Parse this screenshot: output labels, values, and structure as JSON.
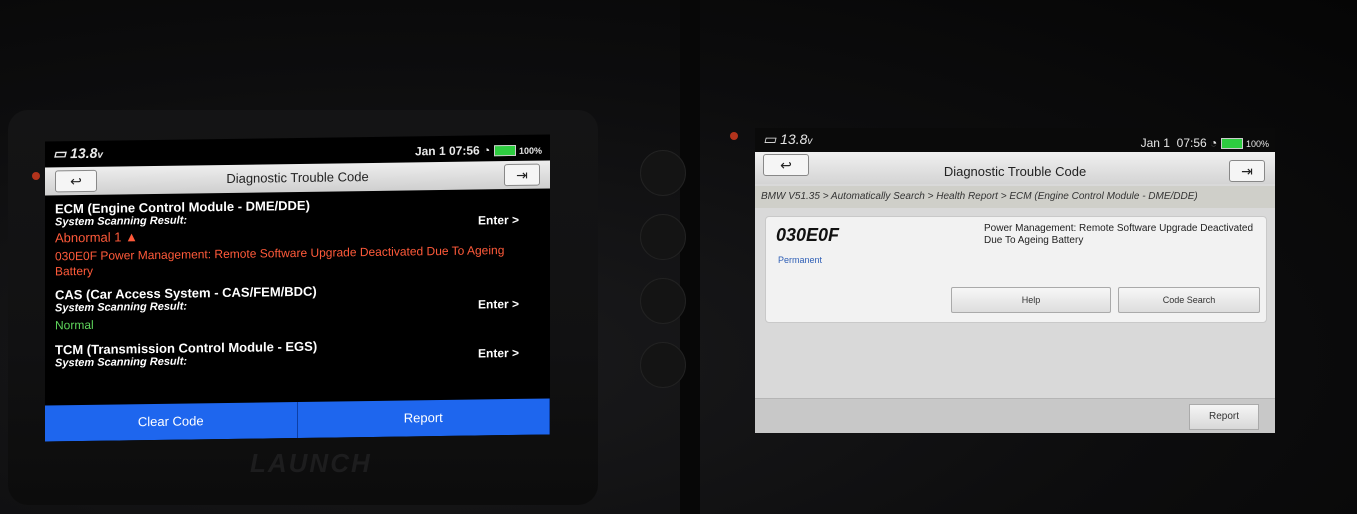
{
  "left_device": {
    "brand": "LAUNCH",
    "status": {
      "voltage": "13.8",
      "voltage_unit": "v",
      "date": "Jan 1",
      "time": "07:56",
      "battery_pct": "100%"
    },
    "header_title": "Diagnostic Trouble Code",
    "modules": [
      {
        "title": "ECM (Engine Control Module - DME/DDE)",
        "scan_label": "System Scanning Result:",
        "status": "Abnormal 1",
        "enter": "Enter >",
        "dtc": "030E0F Power Management: Remote Software Upgrade Deactivated Due To Ageing Battery"
      },
      {
        "title": "CAS (Car Access System - CAS/FEM/BDC)",
        "scan_label": "System Scanning Result:",
        "status": "Normal",
        "enter": "Enter >"
      },
      {
        "title": "TCM (Transmission Control Module - EGS)",
        "scan_label": "System Scanning Result:",
        "enter": "Enter >"
      }
    ],
    "footer": {
      "clear_code": "Clear Code",
      "report": "Report"
    },
    "colors": {
      "abnormal": "#ff5a3a",
      "normal": "#5fd65c",
      "footer": "#1e66ee"
    },
    "icons": {
      "back": "back-arrow-icon",
      "exit": "exit-icon"
    }
  },
  "right_device": {
    "status": {
      "voltage": "13.8",
      "voltage_unit": "v",
      "date": "Jan 1",
      "time": "07:56",
      "battery_pct": "100%"
    },
    "header_title": "Diagnostic Trouble Code",
    "breadcrumb": "BMW V51.35 > Automatically Search > Health Report > ECM (Engine Control Module - DME/DDE)",
    "dtc": {
      "code": "030E0F",
      "state": "Permanent",
      "description": "Power Management: Remote Software Upgrade Deactivated Due To Ageing Battery"
    },
    "buttons": {
      "help": "Help",
      "code_search": "Code Search",
      "report": "Report"
    }
  }
}
